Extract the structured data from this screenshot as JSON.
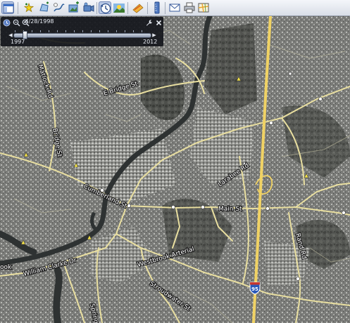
{
  "toolbar": {
    "buttons": [
      {
        "icon": "sidebar-toggle-icon",
        "state": "active"
      },
      {
        "icon": "add-placemark-icon"
      },
      {
        "icon": "add-polygon-icon"
      },
      {
        "icon": "add-path-icon"
      },
      {
        "icon": "add-image-overlay-icon"
      },
      {
        "icon": "record-tour-icon"
      },
      {
        "icon": "historical-imagery-icon",
        "state": "active"
      },
      {
        "icon": "sunlight-icon"
      },
      {
        "icon": "switch-to-sky-icon"
      },
      {
        "icon": "ruler-icon"
      },
      {
        "icon": "email-icon"
      },
      {
        "icon": "print-icon"
      },
      {
        "icon": "view-in-maps-icon"
      }
    ]
  },
  "time_slider": {
    "current_date": "4/28/1998",
    "start_year": "1997",
    "end_year": "2012",
    "position": 0.07
  },
  "map": {
    "labels": {
      "matlock_rd": "Matlock Rd",
      "e_bridge_st": "E Bridge St",
      "bridge_st": "Bridge St",
      "cumberland_st": "Cumberland St",
      "main_st": "Main St",
      "larabee_rd": "Larabee Rd",
      "rand_rd": "Rand Rd",
      "westbrook_arterial": "Westbrook Arterial",
      "william_clarke_dr": "William Clarke Dr",
      "stroudwater_st": "Stroudwater St",
      "spring_st": "Spring St",
      "westbrook_edge": "ook"
    },
    "interstate_shield": "95",
    "colors": {
      "road": "#e9dfa0",
      "highway": "#f0d264",
      "river": "#2e3232"
    }
  }
}
